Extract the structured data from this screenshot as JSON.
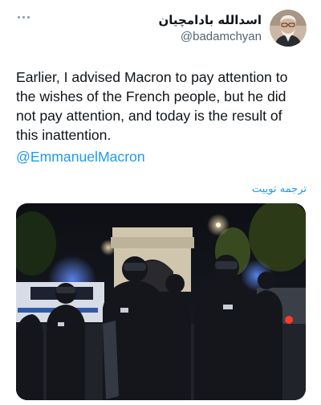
{
  "tweet": {
    "author": {
      "display_name": "اسدالله بادامچیان",
      "handle": "@badamchyan"
    },
    "text": "Earlier, I advised Macron to pay attention to the wishes of the French people, but he did not pay attention, and today is the result of this inattention.",
    "mention": "@EmmanuelMacron",
    "translate_label": "ترجمه توییت",
    "more_icon": "more-horizontal-icon",
    "media_description_icon": "photo"
  },
  "colors": {
    "accent": "#1d9bf0",
    "text": "#0f1419",
    "secondary": "#536471"
  }
}
